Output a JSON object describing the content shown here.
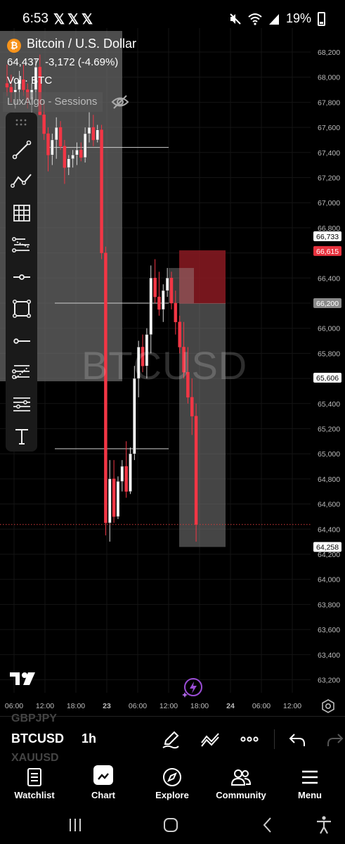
{
  "status_bar": {
    "time": "6:53",
    "notif_icons": [
      "x-logo-icon",
      "x-logo-icon",
      "x-logo-icon"
    ],
    "battery": "19%",
    "battery_level": 0.19
  },
  "header": {
    "title": "Bitcoin / U.S. Dollar",
    "price": "64,437",
    "change": "-3,172 (-4.69%)",
    "volume": "Vol · BTC",
    "indicator": "LuxAlgo - Sessions"
  },
  "watermark": "BTCUSD",
  "toolbar_icons": [
    "trend-line-icon",
    "path-icon",
    "fib-grid-icon",
    "pitchfork-icon",
    "horizontal-ray-icon",
    "rectangle-icon",
    "horizontal-line-icon",
    "fib-retracement-icon",
    "lines-icon",
    "text-icon"
  ],
  "chart_data": {
    "type": "candlestick",
    "y_axis_ticks": [
      "68,200",
      "68,000",
      "67,800",
      "67,600",
      "67,400",
      "67,200",
      "67,000",
      "66,800",
      "66,400",
      "66,200",
      "66,000",
      "65,800",
      "65,400",
      "65,200",
      "65,000",
      "64,800",
      "64,600",
      "64,400",
      "64,200",
      "64,000",
      "63,800",
      "63,600",
      "63,400",
      "63,200"
    ],
    "price_labels": [
      {
        "text": "66,733",
        "style": "white"
      },
      {
        "text": "66,615",
        "style": "red"
      },
      {
        "text": "66,200",
        "style": "grey"
      },
      {
        "text": "65,606",
        "style": "white"
      },
      {
        "text": "64,258",
        "style": "white"
      }
    ],
    "x_axis_ticks": [
      "06:00",
      "12:00",
      "18:00",
      "23",
      "06:00",
      "12:00",
      "18:00",
      "24",
      "06:00",
      "12:00"
    ],
    "ylim": [
      63100,
      68300
    ],
    "candles": [
      [
        67950,
        68100,
        67850,
        67920
      ],
      [
        67920,
        68020,
        67800,
        67880
      ],
      [
        67880,
        67960,
        67750,
        67900
      ],
      [
        67900,
        68050,
        67800,
        67980
      ],
      [
        67980,
        68100,
        67850,
        67900
      ],
      [
        67900,
        67950,
        67750,
        67820
      ],
      [
        67820,
        67950,
        67720,
        67900
      ],
      [
        67900,
        68150,
        67820,
        68080
      ],
      [
        68080,
        68180,
        67850,
        67700
      ],
      [
        67700,
        67800,
        67500,
        67550
      ],
      [
        67550,
        67600,
        67250,
        67380
      ],
      [
        67380,
        67550,
        67300,
        67500
      ],
      [
        67500,
        67680,
        67350,
        67600
      ],
      [
        67600,
        67650,
        67420,
        67450
      ],
      [
        67450,
        67500,
        67150,
        67280
      ],
      [
        67280,
        67380,
        67220,
        67350
      ],
      [
        67350,
        67420,
        67280,
        67380
      ],
      [
        67380,
        67480,
        67300,
        67420
      ],
      [
        67420,
        67480,
        67330,
        67360
      ],
      [
        67360,
        67600,
        67320,
        67550
      ],
      [
        67550,
        67720,
        67480,
        67600
      ],
      [
        67600,
        67700,
        67450,
        67500
      ],
      [
        67500,
        67620,
        67480,
        67580
      ],
      [
        67580,
        67620,
        66550,
        66600
      ],
      [
        66600,
        66650,
        64350,
        64450
      ],
      [
        64450,
        64950,
        64300,
        64800
      ],
      [
        64800,
        64950,
        64450,
        64500
      ],
      [
        64500,
        64820,
        64480,
        64780
      ],
      [
        64780,
        64950,
        64700,
        64900
      ],
      [
        64900,
        65100,
        64650,
        64700
      ],
      [
        64700,
        65050,
        64680,
        65000
      ],
      [
        65000,
        65700,
        64950,
        65600
      ],
      [
        65600,
        65900,
        65450,
        65850
      ],
      [
        65850,
        65950,
        65650,
        65700
      ],
      [
        65700,
        66000,
        65600,
        65950
      ],
      [
        65950,
        66500,
        65800,
        66400
      ],
      [
        66400,
        66550,
        66200,
        66250
      ],
      [
        66250,
        66450,
        66100,
        66150
      ],
      [
        66150,
        66350,
        66050,
        66300
      ],
      [
        66300,
        66480,
        66250,
        66400
      ],
      [
        66400,
        66450,
        66150,
        66200
      ],
      [
        66200,
        66300,
        65950,
        66050
      ],
      [
        66050,
        66100,
        65800,
        65850
      ],
      [
        65850,
        66050,
        65600,
        65650
      ],
      [
        65650,
        65850,
        65400,
        65450
      ],
      [
        65450,
        65600,
        65150,
        65300
      ],
      [
        65300,
        65400,
        64300,
        64437
      ]
    ]
  },
  "symbol_bar": {
    "symbol": "BTCUSD",
    "interval": "1h",
    "prev_symbol": "GBPJPY",
    "next_symbol": "XAUUSD"
  },
  "bottom_nav": [
    {
      "label": "Watchlist",
      "icon": "watchlist-icon"
    },
    {
      "label": "Chart",
      "icon": "chart-icon"
    },
    {
      "label": "Explore",
      "icon": "compass-icon"
    },
    {
      "label": "Community",
      "icon": "community-icon"
    },
    {
      "label": "Menu",
      "icon": "menu-icon"
    }
  ],
  "colors": {
    "up": "#ffffff",
    "down": "#f23645",
    "session_box": "#6b6b6b",
    "target_zone": "#7d7d7d",
    "stop_zone": "#8b1a22"
  }
}
